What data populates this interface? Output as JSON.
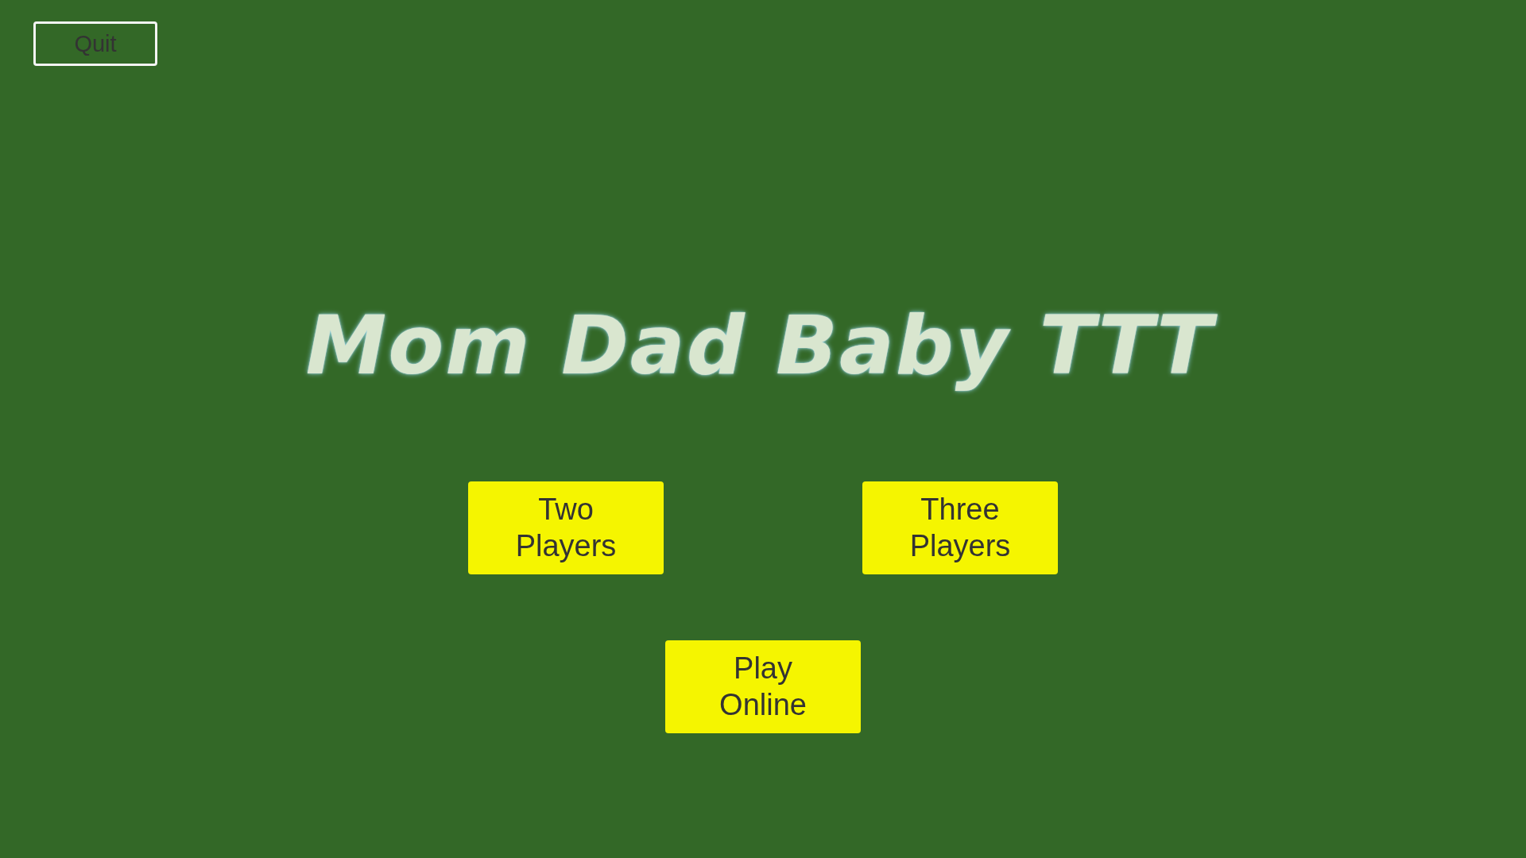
{
  "quit_button": {
    "label": "Quit"
  },
  "title": "Mom Dad Baby TTT",
  "menu_buttons": [
    {
      "label": "Two Players"
    },
    {
      "label": "Three Players"
    },
    {
      "label": "Play Online"
    }
  ]
}
